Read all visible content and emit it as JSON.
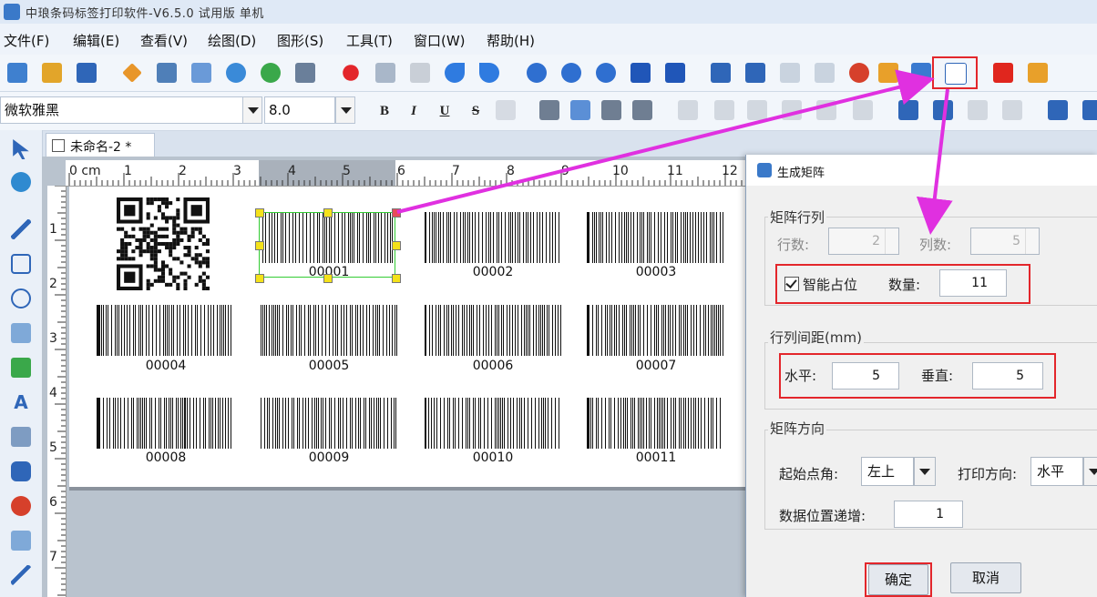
{
  "window": {
    "title": "中琅条码标签打印软件-V6.5.0 试用版 单机"
  },
  "menu": [
    "文件(F)",
    "编辑(E)",
    "查看(V)",
    "绘图(D)",
    "图形(S)",
    "工具(T)",
    "窗口(W)",
    "帮助(H)"
  ],
  "format_bar": {
    "font": "微软雅黑",
    "size": "8.0",
    "bold": "B",
    "italic": "I",
    "underline": "U",
    "strike": "S"
  },
  "document": {
    "tab": "未命名-2 *"
  },
  "ruler": {
    "h": [
      "0 cm",
      "1",
      "2",
      "3",
      "4",
      "5",
      "6",
      "7",
      "8",
      "9",
      "10",
      "11",
      "12"
    ],
    "v": [
      "1",
      "2",
      "3",
      "4",
      "5",
      "6",
      "7"
    ]
  },
  "label": {
    "barcodes": [
      "00001",
      "00002",
      "00003",
      "00004",
      "00005",
      "00006",
      "00007",
      "00008",
      "00009",
      "00010",
      "00011"
    ]
  },
  "dialog": {
    "title": "生成矩阵",
    "grid_group": "矩阵行列",
    "rows_label": "行数:",
    "rows_value": "2",
    "cols_label": "列数:",
    "cols_value": "5",
    "smart_label": "智能占位",
    "count_label": "数量:",
    "count_value": "11",
    "spacing_group": "行列间距(mm)",
    "h_label": "水平:",
    "h_value": "5",
    "v_label": "垂直:",
    "v_value": "5",
    "direction_group": "矩阵方向",
    "start_label": "起始点角:",
    "start_value": "左上",
    "print_dir_label": "打印方向:",
    "print_dir_value": "水平",
    "increment_label": "数据位置递增:",
    "increment_value": "1",
    "ok": "确定",
    "cancel": "取消"
  },
  "colors": {
    "highlight": "#e3262b",
    "arrow": "#e030e0",
    "selection": "#33cc33"
  }
}
